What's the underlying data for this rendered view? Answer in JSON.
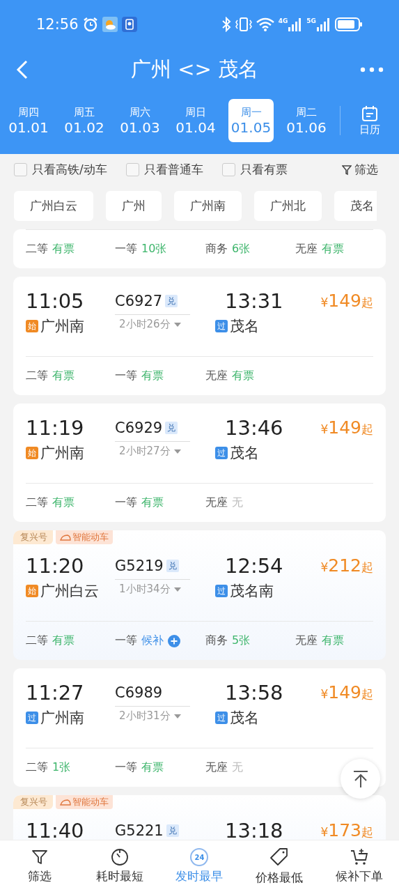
{
  "status_bar": {
    "time": "12:56",
    "net_labels": [
      "4G",
      "5G"
    ]
  },
  "header": {
    "title": "广州 <> 茂名"
  },
  "date_tabs": [
    {
      "weekday": "周四",
      "date": "01.01",
      "selected": false
    },
    {
      "weekday": "周五",
      "date": "01.02",
      "selected": false
    },
    {
      "weekday": "周六",
      "date": "01.03",
      "selected": false
    },
    {
      "weekday": "周日",
      "date": "01.04",
      "selected": false
    },
    {
      "weekday": "周一",
      "date": "01.05",
      "selected": true
    },
    {
      "weekday": "周二",
      "date": "01.06",
      "selected": false
    }
  ],
  "calendar_button": {
    "label": "日历"
  },
  "filters": [
    {
      "label": "只看高铁/动车",
      "checked": false
    },
    {
      "label": "只看普通车",
      "checked": false
    },
    {
      "label": "只看有票",
      "checked": false
    }
  ],
  "filter_button": {
    "label": "筛选"
  },
  "stations": [
    "广州白云",
    "广州",
    "广州南",
    "广州北",
    "茂名"
  ],
  "trains": [
    {
      "seats": [
        {
          "class": "二等",
          "value": "有票",
          "kind": "available"
        },
        {
          "class": "一等",
          "value": "10张",
          "kind": "available"
        },
        {
          "class": "商务",
          "value": "6张",
          "kind": "available"
        },
        {
          "class": "无座",
          "value": "有票",
          "kind": "available"
        }
      ]
    },
    {
      "depart": "11:05",
      "code": "C6927",
      "redeem": "兑",
      "arrive": "13:31",
      "from": "广州南",
      "from_badge": {
        "text": "始",
        "kind": "start"
      },
      "duration": "2小时26分",
      "to": "茂名",
      "to_badge": {
        "text": "过",
        "kind": "pass"
      },
      "price_symbol": "¥",
      "price": "149",
      "price_suffix": "起",
      "seats": [
        {
          "class": "二等",
          "value": "有票",
          "kind": "available"
        },
        {
          "class": "一等",
          "value": "有票",
          "kind": "available"
        },
        {
          "class": "无座",
          "value": "有票",
          "kind": "available"
        }
      ]
    },
    {
      "depart": "11:19",
      "code": "C6929",
      "redeem": "兑",
      "arrive": "13:46",
      "from": "广州南",
      "from_badge": {
        "text": "始",
        "kind": "start"
      },
      "duration": "2小时27分",
      "to": "茂名",
      "to_badge": {
        "text": "过",
        "kind": "pass"
      },
      "price_symbol": "¥",
      "price": "149",
      "price_suffix": "起",
      "seats": [
        {
          "class": "二等",
          "value": "有票",
          "kind": "available"
        },
        {
          "class": "一等",
          "value": "有票",
          "kind": "available"
        },
        {
          "class": "无座",
          "value": "无",
          "kind": "none"
        }
      ]
    },
    {
      "tags": [
        {
          "text": "复兴号",
          "kind": "plain"
        },
        {
          "text": "智能动车",
          "kind": "smart"
        }
      ],
      "depart": "11:20",
      "code": "G5219",
      "redeem": "兑",
      "arrive": "12:54",
      "from": "广州白云",
      "from_badge": {
        "text": "始",
        "kind": "start"
      },
      "duration": "1小时34分",
      "to": "茂名南",
      "to_badge": {
        "text": "过",
        "kind": "pass"
      },
      "price_symbol": "¥",
      "price": "212",
      "price_suffix": "起",
      "seats": [
        {
          "class": "二等",
          "value": "有票",
          "kind": "available"
        },
        {
          "class": "一等",
          "value": "候补",
          "kind": "waitlist"
        },
        {
          "class": "商务",
          "value": "5张",
          "kind": "available"
        },
        {
          "class": "无座",
          "value": "有票",
          "kind": "available"
        }
      ]
    },
    {
      "depart": "11:27",
      "code": "C6989",
      "arrive": "13:58",
      "from": "广州南",
      "from_badge": {
        "text": "过",
        "kind": "pass"
      },
      "duration": "2小时31分",
      "to": "茂名",
      "to_badge": {
        "text": "过",
        "kind": "pass"
      },
      "price_symbol": "¥",
      "price": "149",
      "price_suffix": "起",
      "seats": [
        {
          "class": "二等",
          "value": "1张",
          "kind": "available"
        },
        {
          "class": "一等",
          "value": "有票",
          "kind": "available"
        },
        {
          "class": "无座",
          "value": "无",
          "kind": "none"
        }
      ]
    },
    {
      "tags": [
        {
          "text": "复兴号",
          "kind": "plain"
        },
        {
          "text": "智能动车",
          "kind": "smart"
        }
      ],
      "depart": "11:40",
      "code": "G5221",
      "redeem": "兑",
      "arrive": "13:18",
      "price_symbol": "¥",
      "price": "173",
      "price_suffix": "起"
    }
  ],
  "bottom_nav": [
    {
      "label": "筛选",
      "selected": false
    },
    {
      "label": "耗时最短",
      "selected": false
    },
    {
      "label": "发时最早",
      "badge": "24",
      "selected": true
    },
    {
      "label": "价格最低",
      "selected": false
    },
    {
      "label": "候补下单",
      "selected": false
    }
  ]
}
